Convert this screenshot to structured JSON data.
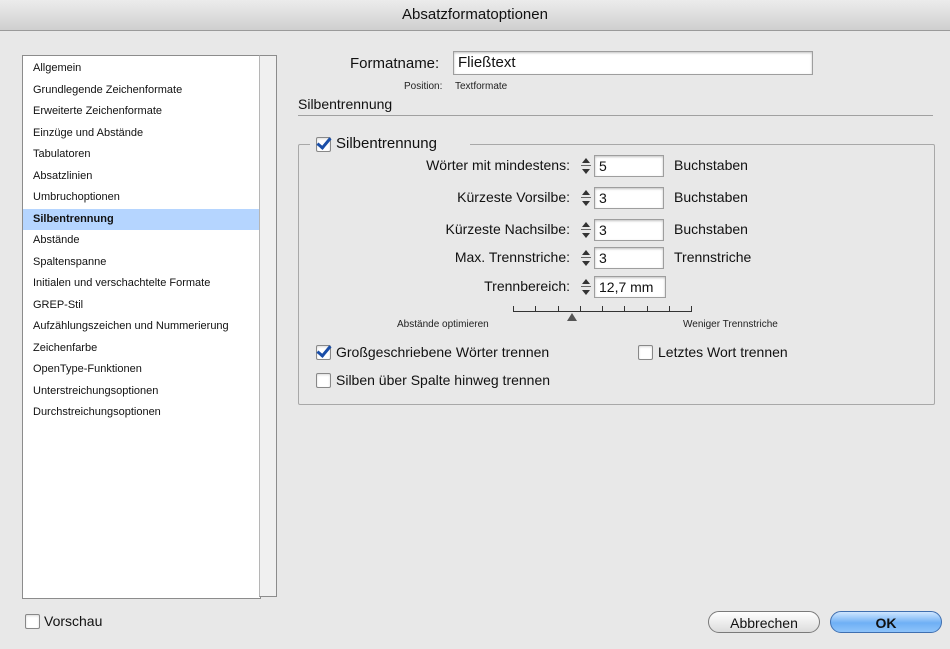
{
  "window": {
    "title": "Absatzformatoptionen"
  },
  "sidebar": {
    "items": [
      {
        "label": "Allgemein"
      },
      {
        "label": "Grundlegende Zeichenformate"
      },
      {
        "label": "Erweiterte Zeichenformate"
      },
      {
        "label": "Einzüge und Abstände"
      },
      {
        "label": "Tabulatoren"
      },
      {
        "label": "Absatzlinien"
      },
      {
        "label": "Umbruchoptionen"
      },
      {
        "label": "Silbentrennung",
        "selected": true
      },
      {
        "label": "Abstände"
      },
      {
        "label": "Spaltenspanne"
      },
      {
        "label": "Initialen und verschachtelte Formate"
      },
      {
        "label": "GREP-Stil"
      },
      {
        "label": "Aufzählungszeichen und Nummerierung"
      },
      {
        "label": "Zeichenfarbe"
      },
      {
        "label": "OpenType-Funktionen"
      },
      {
        "label": "Unterstreichungsoptionen"
      },
      {
        "label": "Durchstreichungsoptionen"
      }
    ]
  },
  "header": {
    "formatname_label": "Formatname:",
    "formatname_value": "Fließtext",
    "position_label": "Position:",
    "position_value": "Textformate",
    "section_title": "Silbentrennung"
  },
  "hyphenation": {
    "enabled_label": "Silbentrennung",
    "enabled": true,
    "rows": [
      {
        "label": "Wörter mit mindestens:",
        "value": "5",
        "unit": "Buchstaben"
      },
      {
        "label": "Kürzeste Vorsilbe:",
        "value": "3",
        "unit": "Buchstaben"
      },
      {
        "label": "Kürzeste Nachsilbe:",
        "value": "3",
        "unit": "Buchstaben"
      },
      {
        "label": "Max. Trennstriche:",
        "value": "3",
        "unit": "Trennstriche"
      },
      {
        "label": "Trennbereich:",
        "value": "12,7 mm",
        "unit": ""
      }
    ],
    "slider": {
      "left_label": "Abstände optimieren",
      "right_label": "Weniger Trennstriche",
      "position_fraction": 0.33
    },
    "options": {
      "capitalized_label": "Großgeschriebene Wörter trennen",
      "capitalized_checked": true,
      "last_word_label": "Letztes Wort trennen",
      "last_word_checked": false,
      "across_column_label": "Silben über Spalte hinweg trennen",
      "across_column_checked": false
    }
  },
  "footer": {
    "preview_label": "Vorschau",
    "preview_checked": false,
    "cancel_label": "Abbrechen",
    "ok_label": "OK"
  },
  "colors": {
    "selection": "#b5d5ff",
    "ok_button": "#6fb0f5",
    "checkmark": "#1a4ea8"
  }
}
